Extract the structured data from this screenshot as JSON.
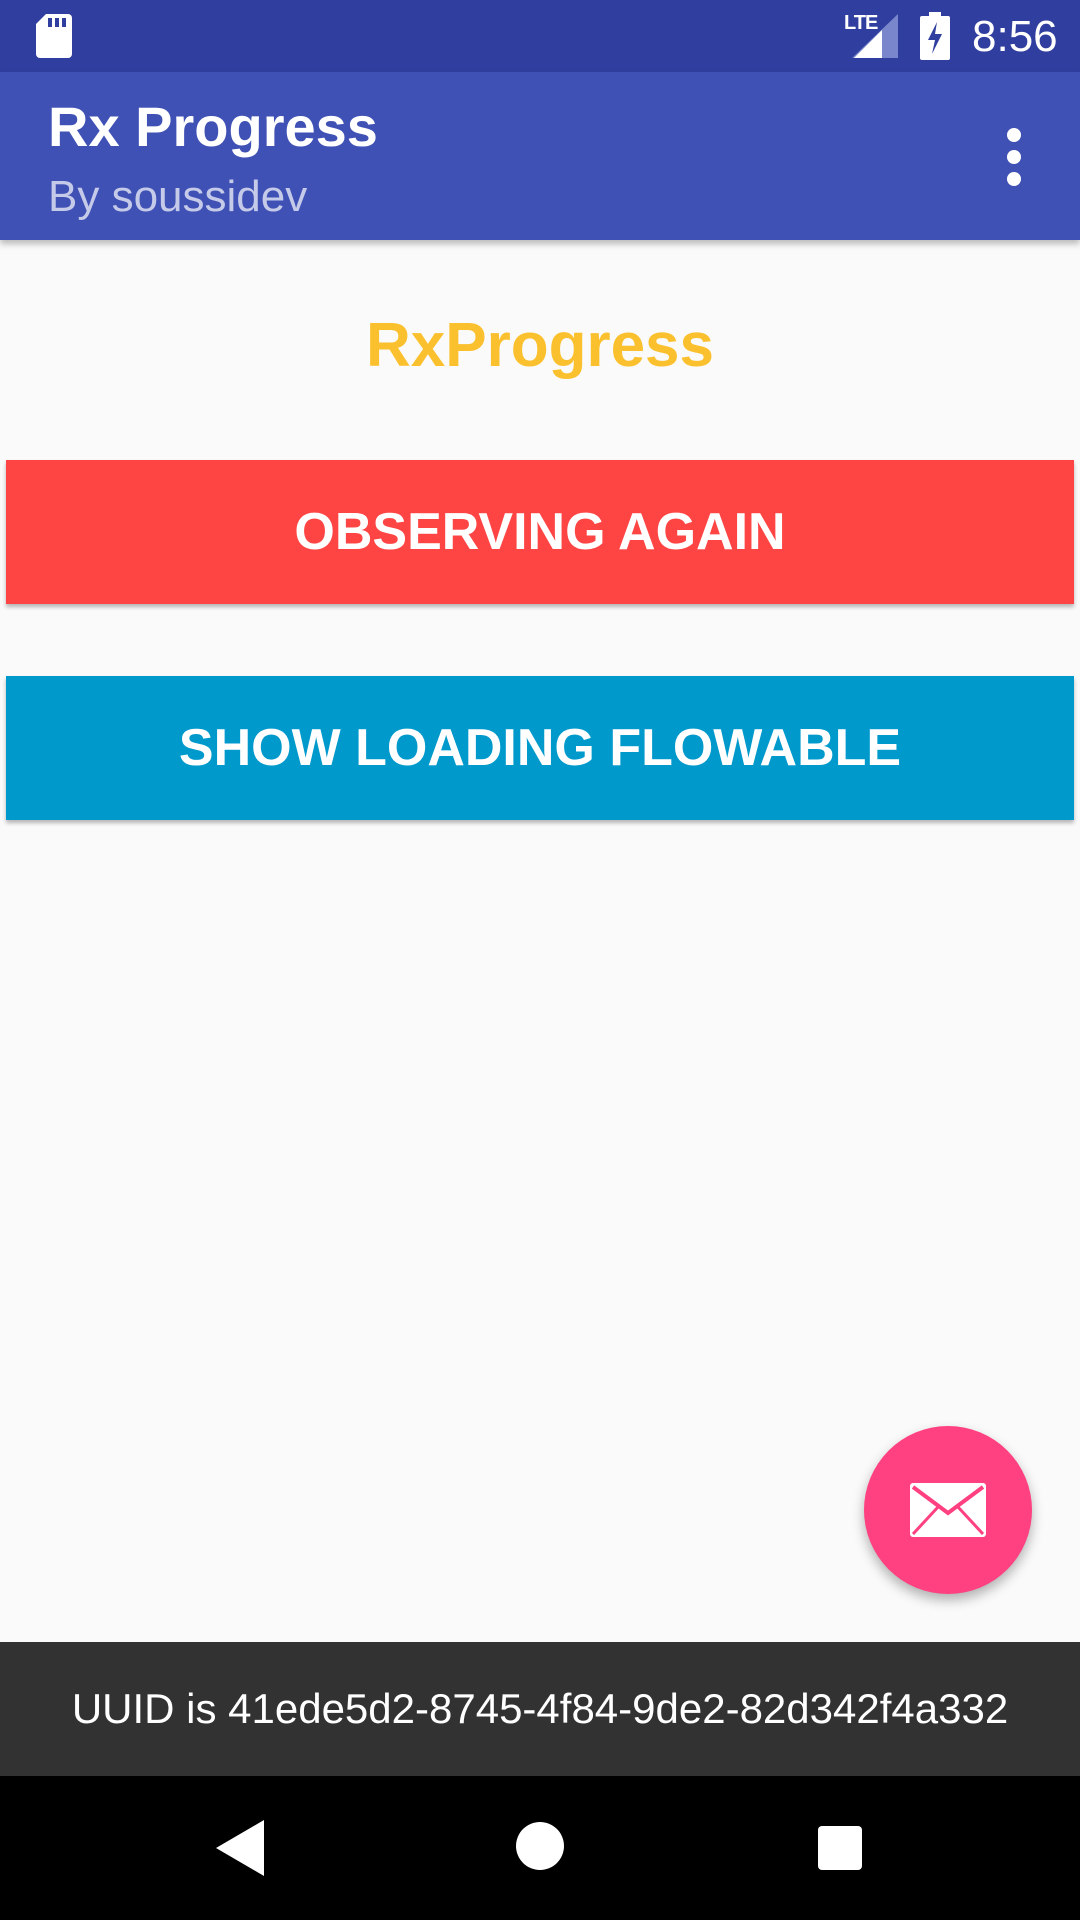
{
  "status_bar": {
    "network": "LTE",
    "time": "8:56",
    "icons": [
      "sd-card-icon",
      "signal-icon",
      "battery-charging-icon"
    ]
  },
  "app_bar": {
    "title": "Rx Progress",
    "subtitle": "By soussidev",
    "overflow_icon": "more-vert-icon"
  },
  "main": {
    "heading": "RxProgress",
    "buttons": [
      {
        "label": "OBSERVING AGAIN",
        "color": "#ff4444"
      },
      {
        "label": "SHOW LOADING FLOWABLE",
        "color": "#0099cc"
      }
    ]
  },
  "fab": {
    "icon": "mail-icon",
    "color": "#ff4081"
  },
  "snackbar": {
    "text": "UUID is 41ede5d2-8745-4f84-9de2-82d342f4a332"
  },
  "nav_bar": {
    "icons": [
      "back-icon",
      "home-icon",
      "recents-icon"
    ]
  },
  "colors": {
    "status_bar": "#303f9f",
    "app_bar": "#3f51b5",
    "heading": "#fbc02d"
  }
}
